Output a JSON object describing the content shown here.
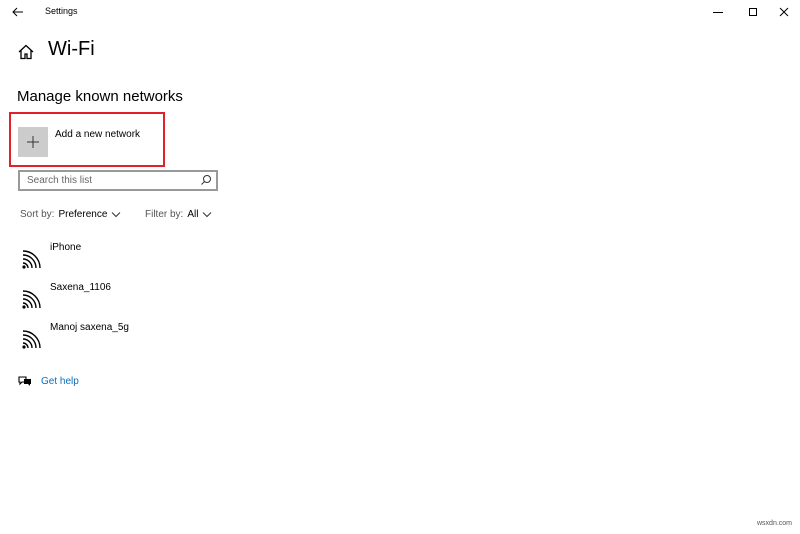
{
  "window": {
    "title": "Settings"
  },
  "header": {
    "page_title": "Wi-Fi"
  },
  "main": {
    "section_title": "Manage known networks",
    "add_network_label": "Add a new network",
    "search": {
      "placeholder": "Search this list",
      "value": ""
    },
    "sort": {
      "prefix": "Sort by:",
      "value": "Preference"
    },
    "filter": {
      "prefix": "Filter by:",
      "value": "All"
    },
    "networks": [
      {
        "name": "iPhone",
        "icon": "wifi-signal-icon"
      },
      {
        "name": "Saxena_1106",
        "icon": "wifi-signal-icon"
      },
      {
        "name": "Manoj saxena_5g",
        "icon": "wifi-signal-icon"
      }
    ],
    "help_link": "Get help"
  },
  "watermark": "wsxdn.com",
  "colors": {
    "highlight_border": "#e0212b",
    "link": "#0a6ebd",
    "add_button_bg": "#cccccc"
  }
}
